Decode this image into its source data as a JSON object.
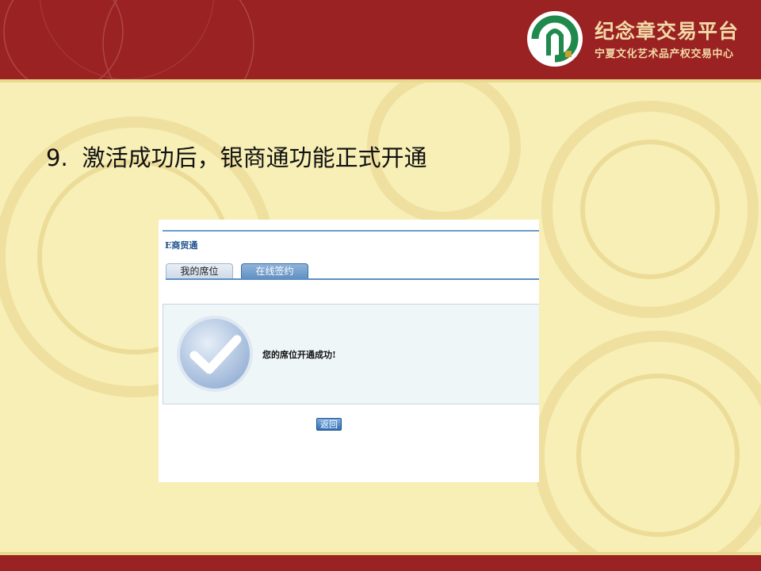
{
  "header": {
    "brand_title": "纪念章交易平台",
    "brand_subtitle": "宁夏文化艺术品产权交易中心",
    "logo_icon": "arch-logo-icon",
    "colors": {
      "band": "#9a2222",
      "brand_text": "#f2d9a8",
      "logo_green": "#1f8a4c"
    }
  },
  "step": {
    "number": "9.",
    "text": "激活成功后，银商通功能正式开通"
  },
  "screenshot": {
    "app_title": "E商贸通",
    "tabs": [
      {
        "label": "我的席位",
        "active": false
      },
      {
        "label": "在线签约",
        "active": true
      }
    ],
    "success_icon": "checkmark-icon",
    "message": "您的席位开通成功!",
    "back_button": "返回"
  }
}
